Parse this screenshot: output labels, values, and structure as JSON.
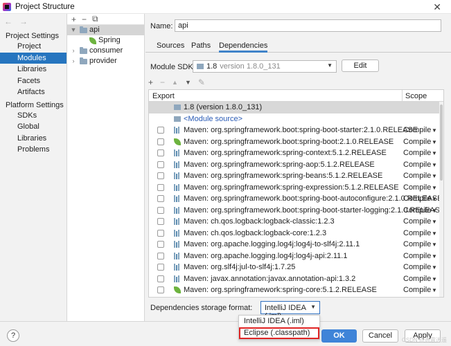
{
  "window": {
    "title": "Project Structure",
    "close_glyph": "✕"
  },
  "nav": {
    "back": "←",
    "forward": "→",
    "group1": "Project Settings",
    "group1_items": [
      "Project",
      "Modules",
      "Libraries",
      "Facets",
      "Artifacts"
    ],
    "group2": "Platform Settings",
    "group2_items": [
      "SDKs",
      "Global Libraries"
    ],
    "problems": "Problems",
    "selected": "Modules"
  },
  "tree": {
    "toolbar": {
      "add": "+",
      "remove": "−",
      "copy": "⧉"
    },
    "items": [
      {
        "label": "api",
        "expanded": true,
        "selected": true
      },
      {
        "label": "Spring",
        "child": true
      },
      {
        "label": "consumer"
      },
      {
        "label": "provider"
      }
    ]
  },
  "module": {
    "name_label": "Name:",
    "name_value": "api",
    "tabs": [
      "Sources",
      "Paths",
      "Dependencies"
    ],
    "active_tab": "Dependencies",
    "sdk_label": "Module SDK:",
    "sdk_value": "1.8",
    "sdk_version": "version 1.8.0_131",
    "edit_button": "Edit"
  },
  "dep_toolbar": {
    "add": "+",
    "remove": "−",
    "up": "▲",
    "down": "▼",
    "edit": "✎"
  },
  "dependencies": {
    "headers": {
      "export": "Export",
      "scope": "Scope"
    },
    "rows": [
      {
        "kind": "sdk",
        "text": "1.8 (version 1.8.0_131)",
        "selected": true
      },
      {
        "kind": "module",
        "text": "<Module source>"
      },
      {
        "kind": "lib",
        "text": "Maven: org.springframework.boot:spring-boot-starter:2.1.0.RELEASE",
        "scope": "Compile"
      },
      {
        "kind": "spring",
        "text": "Maven: org.springframework.boot:spring-boot:2.1.0.RELEASE",
        "scope": "Compile"
      },
      {
        "kind": "lib",
        "text": "Maven: org.springframework:spring-context:5.1.2.RELEASE",
        "scope": "Compile"
      },
      {
        "kind": "lib",
        "text": "Maven: org.springframework:spring-aop:5.1.2.RELEASE",
        "scope": "Compile"
      },
      {
        "kind": "lib",
        "text": "Maven: org.springframework:spring-beans:5.1.2.RELEASE",
        "scope": "Compile"
      },
      {
        "kind": "lib",
        "text": "Maven: org.springframework:spring-expression:5.1.2.RELEASE",
        "scope": "Compile"
      },
      {
        "kind": "lib",
        "text": "Maven: org.springframework.boot:spring-boot-autoconfigure:2.1.0.RELEASE",
        "scope": "Compile"
      },
      {
        "kind": "lib",
        "text": "Maven: org.springframework.boot:spring-boot-starter-logging:2.1.0.RELEASE",
        "scope": "Compile"
      },
      {
        "kind": "lib",
        "text": "Maven: ch.qos.logback:logback-classic:1.2.3",
        "scope": "Compile"
      },
      {
        "kind": "lib",
        "text": "Maven: ch.qos.logback:logback-core:1.2.3",
        "scope": "Compile"
      },
      {
        "kind": "lib",
        "text": "Maven: org.apache.logging.log4j:log4j-to-slf4j:2.11.1",
        "scope": "Compile"
      },
      {
        "kind": "lib",
        "text": "Maven: org.apache.logging.log4j:log4j-api:2.11.1",
        "scope": "Compile"
      },
      {
        "kind": "lib",
        "text": "Maven: org.slf4j:jul-to-slf4j:1.7.25",
        "scope": "Compile"
      },
      {
        "kind": "lib",
        "text": "Maven: javax.annotation:javax.annotation-api:1.3.2",
        "scope": "Compile"
      },
      {
        "kind": "spring",
        "text": "Maven: org.springframework:spring-core:5.1.2.RELEASE",
        "scope": "Compile"
      }
    ]
  },
  "storage": {
    "label": "Dependencies storage format:",
    "value": "IntelliJ IDEA (.iml)",
    "options": [
      "IntelliJ IDEA (.iml)",
      "Eclipse (.classpath)"
    ],
    "highlighted_option": "Eclipse (.classpath)"
  },
  "footer": {
    "help": "?",
    "ok": "OK",
    "cancel": "Cancel",
    "apply": "Apply",
    "watermark": "CSDN @赤霄逍遥"
  },
  "colors": {
    "selection": "#2675bf",
    "ok_button": "#3f84d8",
    "highlight_box": "#e02424",
    "spring_leaf": "#6db33f"
  }
}
